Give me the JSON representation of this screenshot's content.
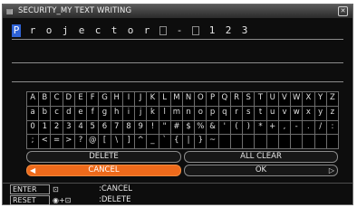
{
  "window": {
    "title": "SECURITY_MY TEXT WRITING",
    "title_icon": "keyboard-icon",
    "close_icon": "close-icon"
  },
  "text_field": {
    "chars": [
      "P",
      "r",
      "o",
      "j",
      "e",
      "c",
      "t",
      "o",
      "r",
      "□",
      "-",
      "□",
      "1",
      "2",
      "3"
    ],
    "cursor_index": 0
  },
  "keyboard": {
    "rows": [
      [
        "A",
        "B",
        "C",
        "D",
        "E",
        "F",
        "G",
        "H",
        "I",
        "J",
        "K",
        "L",
        "M",
        "N",
        "O",
        "P",
        "Q",
        "R",
        "S",
        "T",
        "U",
        "V",
        "W",
        "X",
        "Y",
        "Z"
      ],
      [
        "a",
        "b",
        "c",
        "d",
        "e",
        "f",
        "g",
        "h",
        "i",
        "j",
        "k",
        "l",
        "m",
        "n",
        "o",
        "p",
        "q",
        "r",
        "s",
        "t",
        "u",
        "v",
        "w",
        "x",
        "y",
        "z"
      ],
      [
        "0",
        "1",
        "2",
        "3",
        "4",
        "5",
        "6",
        "7",
        "8",
        "9",
        "!",
        "\"",
        "#",
        "$",
        "%",
        "&",
        "'",
        "(",
        ")",
        "*",
        "+",
        ",",
        "-",
        ".",
        "/",
        ":"
      ],
      [
        ";",
        "<",
        "=",
        ">",
        "?",
        "@",
        "[",
        "\\",
        "]",
        "^",
        "_",
        "`",
        "{",
        "|",
        "}",
        "~",
        "",
        "",
        "",
        "",
        "",
        "",
        "",
        "",
        "",
        ""
      ]
    ]
  },
  "buttons": {
    "delete": "DELETE",
    "all_clear": "ALL CLEAR",
    "cancel": "CANCEL",
    "ok": "OK"
  },
  "legend": [
    {
      "key": "ENTER",
      "symbol": "⊡",
      "desc": ":CANCEL"
    },
    {
      "key": "RESET",
      "symbol": "◉+⊡",
      "desc": ":DELETE"
    }
  ],
  "colors": {
    "selected": "#ee6a1b",
    "cursor": "#2f63d6",
    "background": "#0d0d0d"
  }
}
